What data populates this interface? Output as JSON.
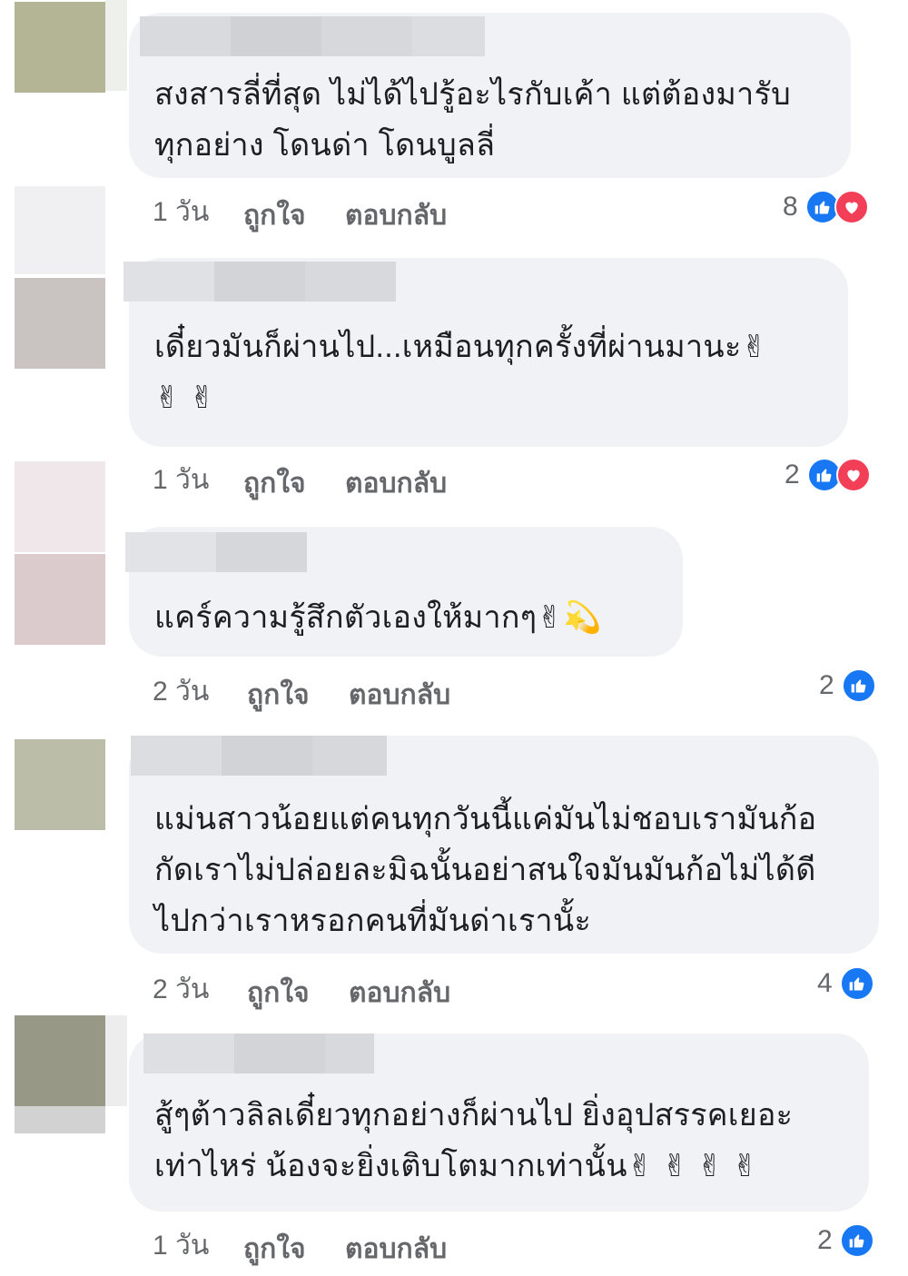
{
  "comments": [
    {
      "text": "สงสารลี่ที่สุด ไม่ได้ไปรู้อะไรกับเค้า แต่ต้องมารับ\nทุกอย่าง โดนด่า โดนบูลลี่",
      "time": "1 วัน",
      "like_label": "ถูกใจ",
      "reply_label": "ตอบกลับ",
      "reaction_count": "8",
      "avatar_colors": [
        "#b4b594",
        "#ffffff",
        "#f0f0f2"
      ]
    },
    {
      "text": "เดี๋ยวมันก็ผ่านไป...เหมือนทุกครั้งที่ผ่านมานะ✌\n✌ ✌",
      "time": "1 วัน",
      "like_label": "ถูกใจ",
      "reply_label": "ตอบกลับ",
      "reaction_count": "2",
      "avatar_colors": [
        "#c9c4c2"
      ]
    },
    {
      "text": "แคร์ความรู้สึกตัวเองให้มากๆ✌💫",
      "time": "2 วัน",
      "like_label": "ถูกใจ",
      "reply_label": "ตอบกลับ",
      "reaction_count": "2",
      "avatar_colors": [
        "#efe7e9",
        "#dccbcc"
      ]
    },
    {
      "text": "แม่นสาวน้อยแต่คนทุกวันนี้แค่มันไม่ชอบเรามันก้อ\nกัดเราไม่ปล่อยละมิฉนั้นอย่าสนใจมันมันก้อไม่ได้ดี\nไปกว่าเราหรอกคนที่มันด่าเรานั้ะ",
      "time": "2 วัน",
      "like_label": "ถูกใจ",
      "reply_label": "ตอบกลับ",
      "reaction_count": "4",
      "avatar_colors": [
        "#bcbda8"
      ]
    },
    {
      "text": "สู้ๆต้าวลิลเดี๋ยวทุกอย่างก็ผ่านไป ยิ่งอุปสรรคเยอะ\nเท่าไหร่ น้องจะยิ่งเติบโตมากเท่านั้น✌ ✌ ✌ ✌",
      "time": "1 วัน",
      "like_label": "ถูกใจ",
      "reply_label": "ตอบกลับ",
      "reaction_count": "2",
      "avatar_colors": [
        "#979886",
        "#d2d2d2"
      ]
    }
  ],
  "colors": {
    "bubble": "#f0f2f5",
    "meta_text": "#65676b",
    "like_blue": "#1877f2",
    "love_red": "#f33e58",
    "name_blur": "#d6d7da"
  },
  "icons": [
    "thumbs-up-icon",
    "heart-icon"
  ]
}
